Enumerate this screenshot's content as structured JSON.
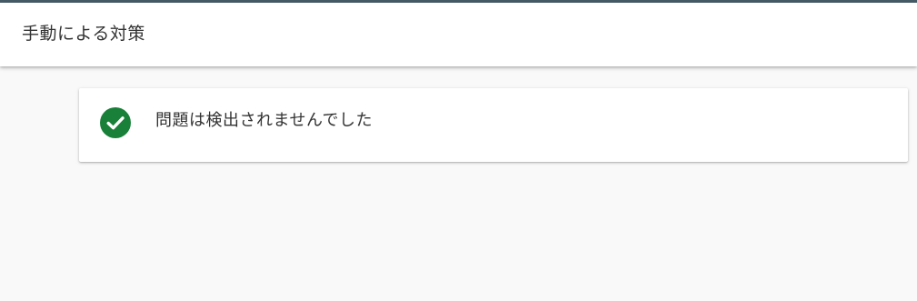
{
  "header": {
    "title": "手動による対策"
  },
  "status_card": {
    "message": "問題は検出されませんでした",
    "icon": "check-circle-icon",
    "icon_color": "#188038"
  },
  "colors": {
    "top_rule": "#455a64",
    "background": "#f9f9f9",
    "card_background": "#ffffff",
    "text": "#333333"
  }
}
